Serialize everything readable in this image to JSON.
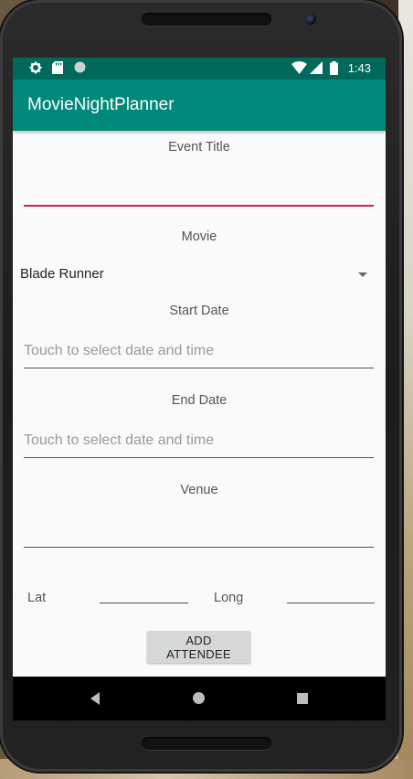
{
  "status_bar": {
    "time": "1:43",
    "left_icons": [
      "settings-icon",
      "sd-card-icon",
      "circle-icon"
    ],
    "right_icons": [
      "wifi-icon",
      "signal-icon",
      "battery-icon"
    ]
  },
  "app_bar": {
    "title": "MovieNightPlanner"
  },
  "form": {
    "event_title_label": "Event Title",
    "event_title_value": "",
    "movie_label": "Movie",
    "movie_selected": "Blade Runner",
    "start_date_label": "Start Date",
    "start_date_placeholder": "Touch to select date and time",
    "end_date_label": "End Date",
    "end_date_placeholder": "Touch to select date and time",
    "venue_label": "Venue",
    "venue_value": "",
    "lat_label": "Lat",
    "long_label": "Long",
    "add_attendee_label": "ADD ATTENDEE"
  },
  "nav_bar": {
    "buttons": [
      "back-icon",
      "home-icon",
      "recents-icon"
    ]
  },
  "colors": {
    "status_bar": "#00695c",
    "app_bar": "#00897b",
    "focus_accent": "#d81b60",
    "screen_bg": "#fafafa"
  }
}
